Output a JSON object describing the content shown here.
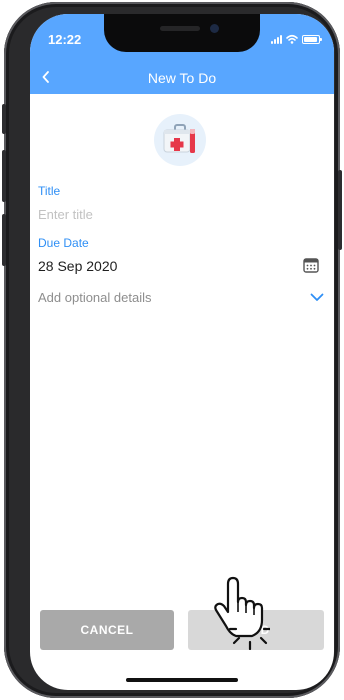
{
  "status_bar": {
    "time": "12:22",
    "icons": [
      "signal-icon",
      "wifi-icon",
      "battery-icon"
    ]
  },
  "header": {
    "title": "New To Do",
    "back_icon": "chevron-left-icon",
    "color": "#58a6ff"
  },
  "app_icon": {
    "name": "first-aid-kit-icon"
  },
  "form": {
    "title_label": "Title",
    "title_placeholder": "Enter title",
    "title_value": "",
    "due_label": "Due Date",
    "due_value": "28 Sep 2020",
    "calendar_icon": "calendar-icon",
    "details_text": "Add optional details",
    "details_icon": "chevron-down-icon",
    "accent": "#2f8ff5"
  },
  "actions": {
    "cancel_label": "CANCEL",
    "add_label": "ADD"
  },
  "overlay": {
    "icon": "tap-hand-pointer-icon"
  }
}
